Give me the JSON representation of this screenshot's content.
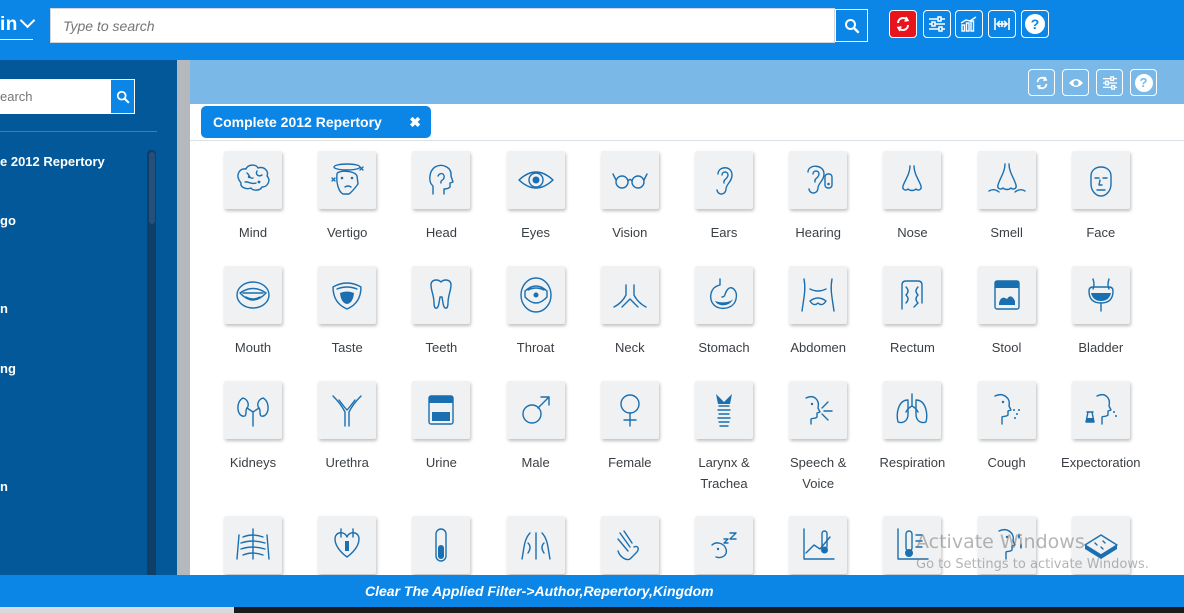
{
  "app": {
    "brand": "in"
  },
  "search": {
    "placeholder": "Type to search"
  },
  "sidebar": {
    "search_placeholder": "earch",
    "items": [
      {
        "label": "e 2012 Repertory"
      },
      {
        "label": "go"
      },
      {
        "label": "n"
      },
      {
        "label": "ng"
      },
      {
        "label": "n"
      }
    ]
  },
  "tab": {
    "label": "Complete 2012 Repertory",
    "close": "✖"
  },
  "rubrics": [
    {
      "label": "Mind",
      "icon": "brain-icon"
    },
    {
      "label": "Vertigo",
      "icon": "dizzy-head-icon"
    },
    {
      "label": "Head",
      "icon": "head-icon"
    },
    {
      "label": "Eyes",
      "icon": "eye-icon"
    },
    {
      "label": "Vision",
      "icon": "glasses-icon"
    },
    {
      "label": "Ears",
      "icon": "ear-icon"
    },
    {
      "label": "Hearing",
      "icon": "hearing-aid-icon"
    },
    {
      "label": "Nose",
      "icon": "nose-icon"
    },
    {
      "label": "Smell",
      "icon": "smell-icon"
    },
    {
      "label": "Face",
      "icon": "face-icon"
    },
    {
      "label": "Mouth",
      "icon": "mouth-icon"
    },
    {
      "label": "Taste",
      "icon": "tongue-icon"
    },
    {
      "label": "Teeth",
      "icon": "tooth-icon"
    },
    {
      "label": "Throat",
      "icon": "throat-icon"
    },
    {
      "label": "Neck",
      "icon": "neck-icon"
    },
    {
      "label": "Stomach",
      "icon": "stomach-icon"
    },
    {
      "label": "Abdomen",
      "icon": "abdomen-icon"
    },
    {
      "label": "Rectum",
      "icon": "intestine-icon"
    },
    {
      "label": "Stool",
      "icon": "stool-container-icon"
    },
    {
      "label": "Bladder",
      "icon": "bladder-icon"
    },
    {
      "label": "Kidneys",
      "icon": "kidneys-icon"
    },
    {
      "label": "Urethra",
      "icon": "urethra-icon"
    },
    {
      "label": "Urine",
      "icon": "urine-container-icon"
    },
    {
      "label": "Male",
      "icon": "male-symbol-icon"
    },
    {
      "label": "Female",
      "icon": "female-symbol-icon"
    },
    {
      "label": "Larynx & Trachea",
      "icon": "larynx-icon"
    },
    {
      "label": "Speech & Voice",
      "icon": "speech-icon"
    },
    {
      "label": "Respiration",
      "icon": "lungs-icon"
    },
    {
      "label": "Cough",
      "icon": "cough-icon"
    },
    {
      "label": "Expectoration",
      "icon": "expectoration-icon"
    },
    {
      "label": "",
      "icon": "chest-icon"
    },
    {
      "label": "",
      "icon": "heart-icon"
    },
    {
      "label": "",
      "icon": "test-tube-icon"
    },
    {
      "label": "",
      "icon": "back-icon"
    },
    {
      "label": "",
      "icon": "hand-icon"
    },
    {
      "label": "",
      "icon": "sleep-icon"
    },
    {
      "label": "",
      "icon": "thermometer-chart-icon"
    },
    {
      "label": "",
      "icon": "thermometer-icon"
    },
    {
      "label": "",
      "icon": "sweating-face-icon"
    },
    {
      "label": "",
      "icon": "skin-icon"
    }
  ],
  "footer": {
    "text": "Clear The Applied Filter->Author,Repertory,Kingdom"
  },
  "watermark": {
    "line1": "Activate Windows",
    "line2": "Go to Settings to activate Windows."
  },
  "colors": {
    "primary": "#0b86e6",
    "sidebar": "#03589a",
    "subbar": "#7ab8e8",
    "refresh_red": "#e8131b",
    "icon_blue": "#1a6fb0"
  }
}
